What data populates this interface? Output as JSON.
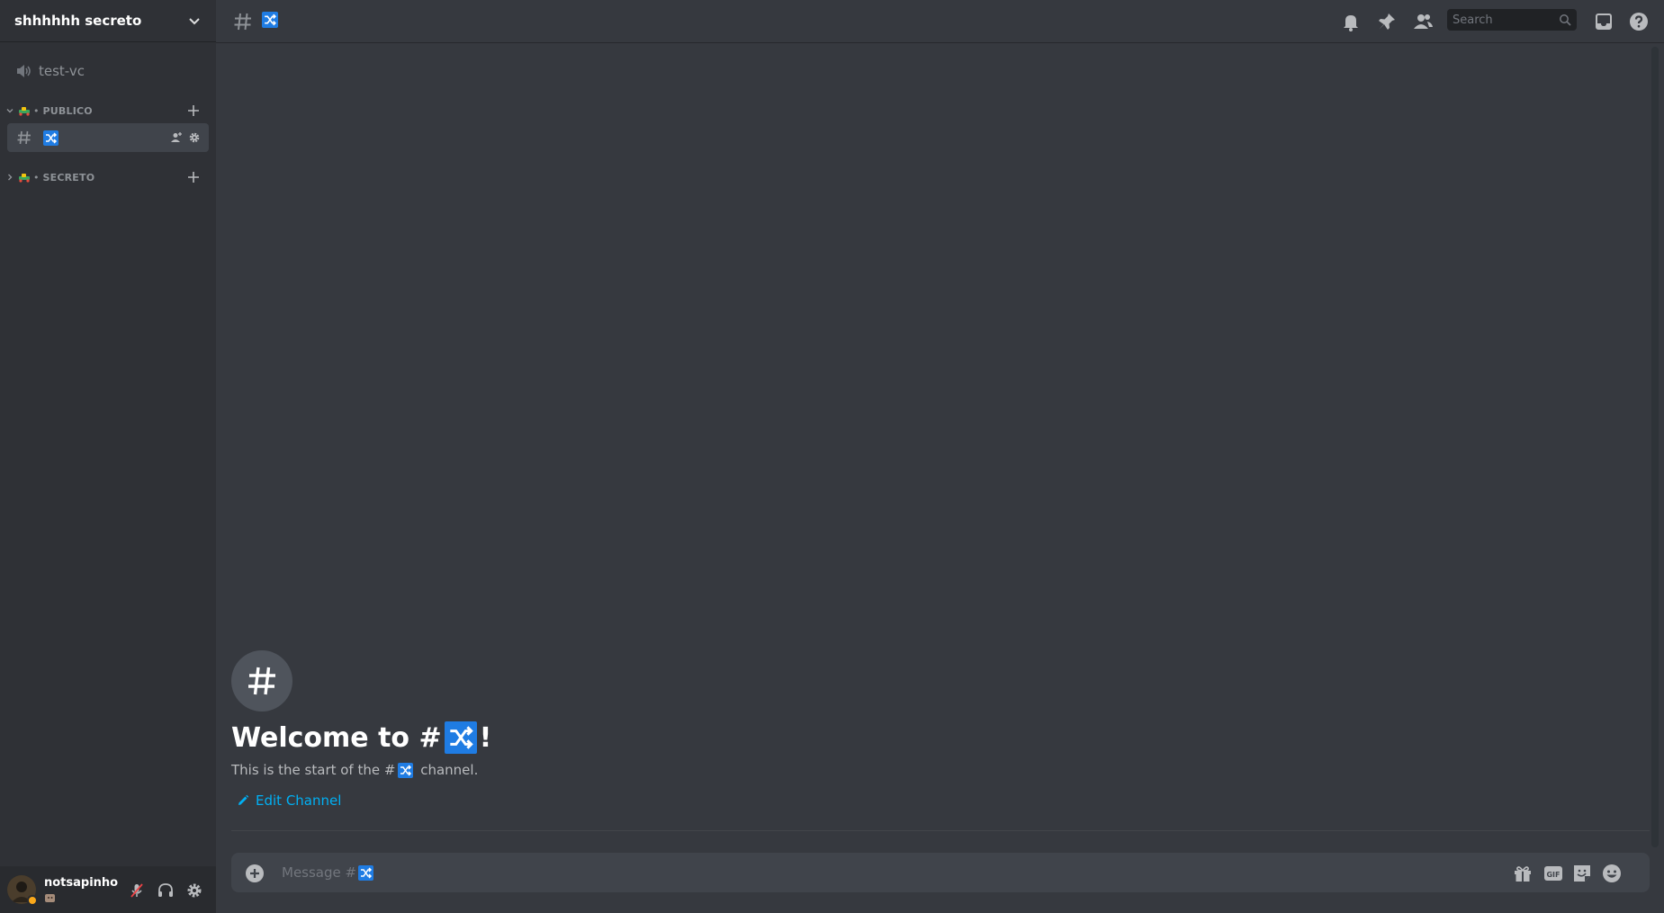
{
  "server": {
    "name": "shhhhhh secreto"
  },
  "sidebar": {
    "voice_channel": {
      "label": "test-vc"
    },
    "categories": [
      {
        "label": "PUBLICO",
        "expanded": true
      },
      {
        "label": "SECRETO",
        "expanded": false
      }
    ],
    "active_channel": {
      "emoji": "twisted-rightwards-arrows"
    }
  },
  "user": {
    "name": "notsapinho",
    "status": "idle"
  },
  "header": {
    "channel_emoji": "twisted-rightwards-arrows",
    "search_placeholder": "Search"
  },
  "welcome": {
    "title_prefix": "Welcome to #",
    "title_suffix": "!",
    "sub_prefix": "This is the start of the #",
    "sub_suffix": " channel.",
    "edit_label": "Edit Channel"
  },
  "composer": {
    "placeholder_prefix": "Message #"
  },
  "colors": {
    "sidebar_bg": "#2f3136",
    "main_bg": "#36393f",
    "accent_link": "#00b0f4",
    "emoji_blue": "#1f7ce3",
    "idle": "#faa81a"
  }
}
